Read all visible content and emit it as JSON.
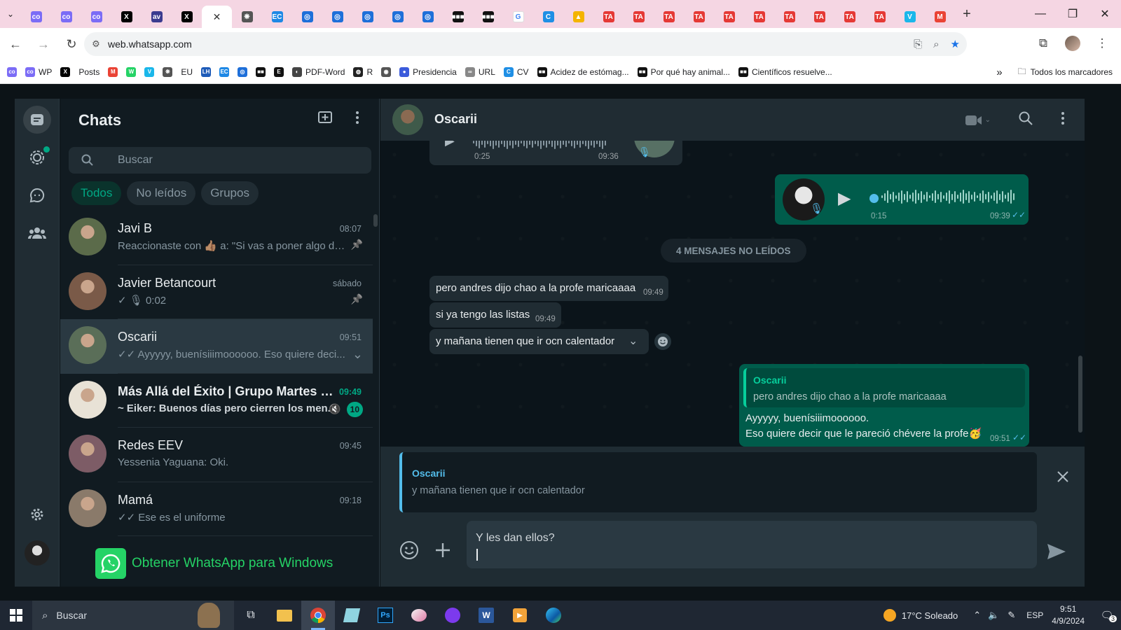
{
  "browser": {
    "url": "web.whatsapp.com",
    "tabs": [
      {
        "icon": "copilot-icon",
        "color": "#7b6cf6",
        "text": "co"
      },
      {
        "icon": "copilot-icon",
        "color": "#7b6cf6",
        "text": "co"
      },
      {
        "icon": "copilot-icon",
        "color": "#7b6cf6",
        "text": "co"
      },
      {
        "icon": "x-icon",
        "color": "#000000",
        "text": "X"
      },
      {
        "icon": "copilot-icon",
        "color": "#3b3b8f",
        "text": "av"
      },
      {
        "icon": "x-icon",
        "color": "#000000",
        "text": "X"
      },
      {
        "icon": "close-icon",
        "color": "",
        "text": "✕"
      },
      {
        "icon": "openai-icon",
        "color": "#555555",
        "text": "❋"
      },
      {
        "icon": "ec-icon",
        "color": "#1e88e5",
        "text": "EC"
      },
      {
        "icon": "user-icon",
        "color": "#1e6fd9",
        "text": "◎"
      },
      {
        "icon": "user-icon",
        "color": "#1e6fd9",
        "text": "◎"
      },
      {
        "icon": "user-icon",
        "color": "#1e6fd9",
        "text": "◎"
      },
      {
        "icon": "user-icon",
        "color": "#1e6fd9",
        "text": "◎"
      },
      {
        "icon": "user-icon",
        "color": "#1e6fd9",
        "text": "◎"
      },
      {
        "icon": "dots-icon",
        "color": "#111111",
        "text": "■■■"
      },
      {
        "icon": "dots-icon",
        "color": "#111111",
        "text": "■■■"
      },
      {
        "icon": "google-icon",
        "color": "#ffffff",
        "text": "G"
      },
      {
        "icon": "c-icon",
        "color": "#1f8fe5",
        "text": "C"
      },
      {
        "icon": "drive-icon",
        "color": "#f4b400",
        "text": "▲"
      },
      {
        "icon": "red-icon",
        "color": "#e53935",
        "text": "TA"
      },
      {
        "icon": "red-icon",
        "color": "#e53935",
        "text": "TA"
      },
      {
        "icon": "red-icon",
        "color": "#e53935",
        "text": "TA"
      },
      {
        "icon": "red-icon",
        "color": "#e53935",
        "text": "TA"
      },
      {
        "icon": "red-icon",
        "color": "#e53935",
        "text": "TA"
      },
      {
        "icon": "red-icon",
        "color": "#e53935",
        "text": "TA"
      },
      {
        "icon": "red-icon",
        "color": "#e53935",
        "text": "TA"
      },
      {
        "icon": "red-icon",
        "color": "#e53935",
        "text": "TA"
      },
      {
        "icon": "red-icon",
        "color": "#e53935",
        "text": "TA"
      },
      {
        "icon": "red-icon",
        "color": "#e53935",
        "text": "TA"
      },
      {
        "icon": "vimeo-icon",
        "color": "#1ab7ea",
        "text": "V"
      },
      {
        "icon": "gmail-icon",
        "color": "#ea4335",
        "text": "M"
      }
    ],
    "bookmarks": [
      {
        "label": "",
        "icon": "copilot-icon",
        "color": "#7b6cf6",
        "text": "co"
      },
      {
        "label": "WP",
        "icon": "copilot-icon",
        "color": "#7b6cf6",
        "text": "co"
      },
      {
        "label": "",
        "icon": "x-icon",
        "color": "#000000",
        "text": "X"
      },
      {
        "label": "Posts",
        "icon": "",
        "color": "",
        "text": ""
      },
      {
        "label": "",
        "icon": "gmail-icon",
        "color": "#ea4335",
        "text": "M"
      },
      {
        "label": "",
        "icon": "whatsapp-icon",
        "color": "#25d366",
        "text": "W"
      },
      {
        "label": "",
        "icon": "vimeo-icon",
        "color": "#1ab7ea",
        "text": "V"
      },
      {
        "label": "",
        "icon": "openai-icon",
        "color": "#555555",
        "text": "❋"
      },
      {
        "label": "EU",
        "icon": "",
        "color": "",
        "text": ""
      },
      {
        "label": "",
        "icon": "lh-icon",
        "color": "#1e5bb8",
        "text": "LH"
      },
      {
        "label": "",
        "icon": "ec-icon",
        "color": "#1e88e5",
        "text": "EC"
      },
      {
        "label": "",
        "icon": "user-icon",
        "color": "#1e6fd9",
        "text": "◎"
      },
      {
        "label": "",
        "icon": "dots-icon",
        "color": "#111111",
        "text": "■■"
      },
      {
        "label": "",
        "icon": "e-icon",
        "color": "#111111",
        "text": "E"
      },
      {
        "label": "PDF-Word",
        "icon": "pdf-icon",
        "color": "#444444",
        "text": "◐"
      },
      {
        "label": "R",
        "icon": "globe-icon",
        "color": "#222222",
        "text": "◍"
      },
      {
        "label": "",
        "icon": "seal-icon",
        "color": "#555555",
        "text": "◉"
      },
      {
        "label": "Presidencia",
        "icon": "flag-icon",
        "color": "#3b5bdb",
        "text": "●"
      },
      {
        "label": "URL",
        "icon": "link-icon",
        "color": "#888888",
        "text": "∞"
      },
      {
        "label": "CV",
        "icon": "c-icon",
        "color": "#1f8fe5",
        "text": "C"
      },
      {
        "label": "Acidez de estómag...",
        "icon": "dots-icon",
        "color": "#111111",
        "text": "■■"
      },
      {
        "label": "Por qué hay animal...",
        "icon": "dots-icon",
        "color": "#111111",
        "text": "■■"
      },
      {
        "label": "Científicos resuelve...",
        "icon": "dots-icon",
        "color": "#111111",
        "text": "■■"
      }
    ],
    "all_bookmarks": "Todos los marcadores"
  },
  "sidebar": {
    "title": "Chats",
    "search_placeholder": "Buscar",
    "filters": [
      "Todos",
      "No leídos",
      "Grupos"
    ],
    "chats": [
      {
        "name": "Javi B",
        "time": "08:07",
        "preview": "Reaccionaste con 👍🏽 a: \"Si vas a poner algo de ...",
        "pinned": true,
        "avatar": "#5b6b4a"
      },
      {
        "name": "Javier Betancourt",
        "time": "sábado",
        "preview": "✓ 🎙 0:02",
        "pinned": true,
        "avatar": "#7a5a48"
      },
      {
        "name": "Oscarii",
        "time": "09:51",
        "preview": "✓✓ Ayyyyy, buenísiiimoooooo. Eso quiere deci...",
        "selected": true,
        "avatar": "#5a6e58"
      },
      {
        "name": "Más Allá del Éxito | Grupo Martes 7...",
        "time": "09:49",
        "preview": "~ Eiker: Buenos días pero cierren los men...",
        "unread": "10",
        "muted": true,
        "bold": true,
        "avatar": "#e8e2d6"
      },
      {
        "name": "Redes EEV",
        "time": "09:45",
        "preview": "Yessenia Yaguana: Oki.",
        "avatar": "#7d5c66"
      },
      {
        "name": "Mamá",
        "time": "09:18",
        "preview": "✓✓ Ese es el uniforme",
        "avatar": "#8a7a6a"
      }
    ],
    "get_windows": "Obtener WhatsApp para Windows"
  },
  "conversation": {
    "contact": "Oscarii",
    "voice_in": {
      "duration": "0:25",
      "time": "09:36"
    },
    "voice_out": {
      "duration": "0:15",
      "time": "09:39"
    },
    "unread_divider": "4 MENSAJES NO LEÍDOS",
    "incoming": [
      {
        "text": "pero andres dijo chao a la profe maricaaaa",
        "time": "09:49"
      },
      {
        "text": "si ya tengo las listas",
        "time": "09:49"
      },
      {
        "text": "y mañana tienen que ir ocn calentador",
        "time": ""
      }
    ],
    "reply_out": {
      "quoted_author": "Oscarii",
      "quoted_text": "pero andres dijo chao a la profe maricaaaa",
      "line1": "Ayyyyy, buenísiiimoooooo.",
      "line2": "Eso quiere decir que le pareció chévere la profe🥳",
      "time": "09:51"
    },
    "replying_to": {
      "author": "Oscarii",
      "text": "y mañana tienen que ir ocn calentador"
    },
    "draft": "Y les dan ellos?"
  },
  "taskbar": {
    "search": "Buscar",
    "weather": "17°C  Soleado",
    "lang": "ESP",
    "time": "9:51",
    "date": "4/9/2024",
    "notifications": "3"
  }
}
